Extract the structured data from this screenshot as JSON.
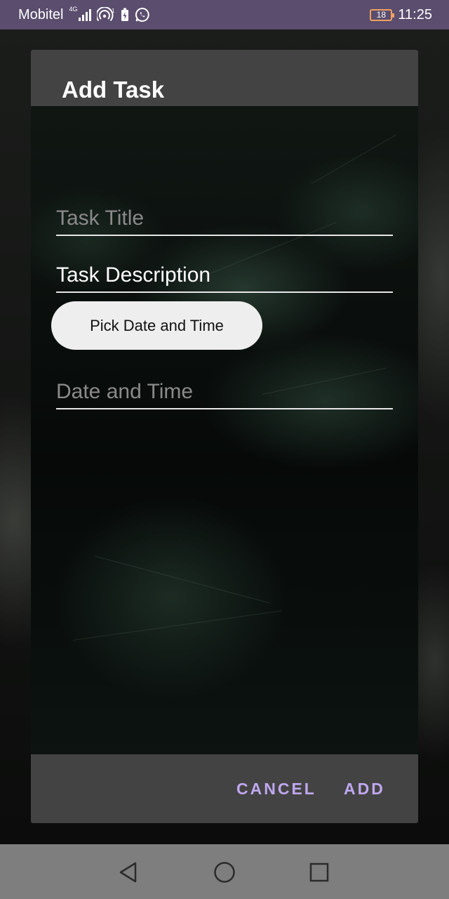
{
  "status_bar": {
    "carrier": "Mobitel",
    "network_type": "4G",
    "battery_level": "18",
    "time": "11:25",
    "icons": [
      "signal-icon",
      "hotspot-icon",
      "battery-saver-icon",
      "whatsapp-icon",
      "battery-icon"
    ]
  },
  "dialog": {
    "title": "Add Task",
    "fields": {
      "task_title": {
        "placeholder": "Task Title",
        "value": ""
      },
      "task_description": {
        "placeholder": "Task Description",
        "value": "Task Description"
      },
      "date_time": {
        "placeholder": "Date and Time",
        "value": ""
      }
    },
    "pick_button_label": "Pick Date and Time",
    "cancel_label": "CANCEL",
    "add_label": "ADD"
  },
  "nav_bar": {
    "icons": [
      "back-icon",
      "home-icon",
      "recent-apps-icon"
    ]
  },
  "colors": {
    "status_bar": "#5a4d6e",
    "dialog_chrome": "#434343",
    "action_text": "#bfa8f0",
    "nav_bar": "#7e7e7e"
  }
}
